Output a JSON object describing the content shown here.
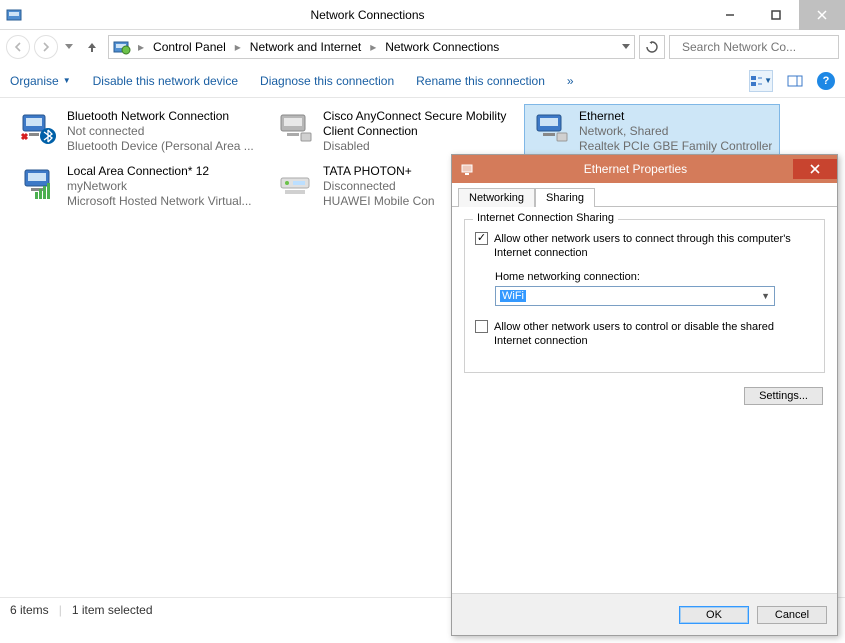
{
  "window": {
    "title": "Network Connections"
  },
  "breadcrumb": {
    "a": "Control Panel",
    "b": "Network and Internet",
    "c": "Network Connections"
  },
  "search": {
    "placeholder": "Search Network Co..."
  },
  "cmd": {
    "organise": "Organise",
    "disable": "Disable this network device",
    "diagnose": "Diagnose this connection",
    "rename": "Rename this connection",
    "more": "»"
  },
  "items": [
    {
      "name": "Bluetooth Network Connection",
      "status": "Not connected",
      "device": "Bluetooth Device (Personal Area ..."
    },
    {
      "name": "Cisco AnyConnect Secure Mobility Client Connection",
      "status": "Disabled",
      "device": ""
    },
    {
      "name": "Ethernet",
      "status": "Network, Shared",
      "device": "Realtek PCIe GBE Family Controller"
    },
    {
      "name": "Local Area Connection* 12",
      "status": "myNetwork",
      "device": "Microsoft Hosted Network Virtual..."
    },
    {
      "name": "TATA PHOTON+",
      "status": "Disconnected",
      "device": "HUAWEI Mobile Con"
    }
  ],
  "statusbar": {
    "count": "6 items",
    "selected": "1 item selected"
  },
  "dialog": {
    "title": "Ethernet Properties",
    "tabs": {
      "networking": "Networking",
      "sharing": "Sharing"
    },
    "group_legend": "Internet Connection Sharing",
    "chk1": "Allow other network users to connect through this computer's Internet connection",
    "home_label": "Home networking connection:",
    "home_value": "WiFi",
    "chk2": "Allow other network users to control or disable the shared Internet connection",
    "settings_btn": "Settings...",
    "ok": "OK",
    "cancel": "Cancel"
  }
}
